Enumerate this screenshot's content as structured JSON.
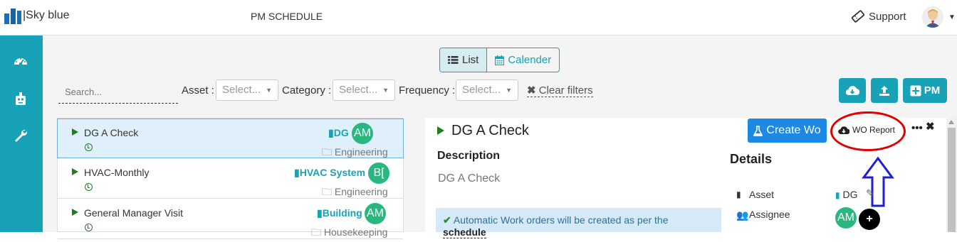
{
  "app": {
    "logo_text": "|Sky blue",
    "title": "PM SCHEDULE",
    "support_label": "Support"
  },
  "sidebar": {
    "items": [
      {
        "icon": "dashboard-icon"
      },
      {
        "icon": "robot-icon"
      },
      {
        "icon": "wrench-icon"
      }
    ]
  },
  "view_toggle": {
    "list_label": "List",
    "calendar_label": "Calender",
    "active": "List"
  },
  "filters": {
    "search_placeholder": "Search...",
    "asset_label": "Asset :",
    "asset_placeholder": "Select...",
    "category_label": "Category :",
    "category_placeholder": "Select...",
    "frequency_label": "Frequency :",
    "frequency_placeholder": "Select...",
    "clear_label": "Clear filters"
  },
  "toolbar": {
    "pm_button_label": "PM"
  },
  "pm_list": [
    {
      "name": "DG A Check",
      "asset": "DG",
      "assignee": "AM",
      "category": "Engineering",
      "selected": true
    },
    {
      "name": "HVAC-Monthly",
      "asset": "HVAC System",
      "assignee": "B[",
      "category": "Engineering",
      "selected": false
    },
    {
      "name": "General Manager Visit",
      "asset": "Building",
      "assignee": "AM",
      "category": "Housekeeping",
      "selected": false
    }
  ],
  "detail": {
    "title": "DG A Check",
    "create_wo_label": "Create Wo",
    "wo_report_label": "WO Report",
    "description_heading": "Description",
    "description_value": "DG A Check",
    "details_heading": "Details",
    "asset_label": "Asset",
    "asset_value": "DG",
    "assignee_label": "Assignee",
    "assignee_value": "AM",
    "alert_text": "Automatic Work orders will be created as per the",
    "alert_link": "schedule"
  },
  "colors": {
    "teal": "#17a2b8",
    "blue_button": "#1e88e5",
    "green_avatar": "#28b77f",
    "annotation_red": "#e00000",
    "annotation_blue": "#1f1fd0"
  }
}
